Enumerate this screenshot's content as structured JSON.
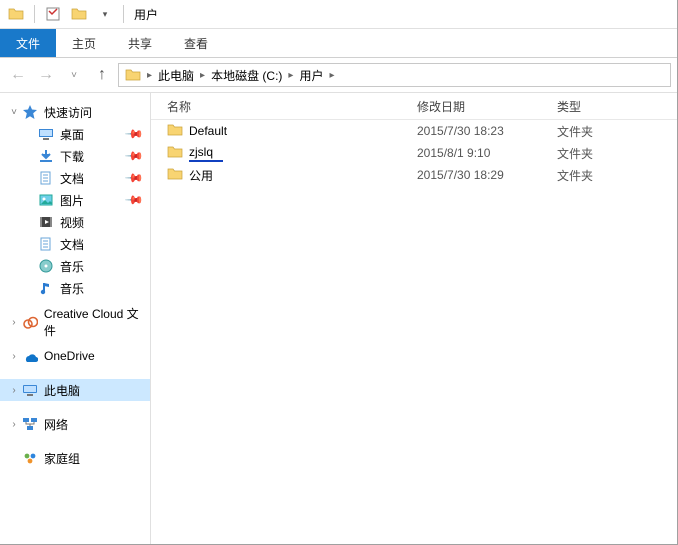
{
  "title": "用户",
  "ribbon": {
    "file": "文件",
    "home": "主页",
    "share": "共享",
    "view": "查看"
  },
  "breadcrumb": [
    "此电脑",
    "本地磁盘 (C:)",
    "用户"
  ],
  "columns": {
    "name": "名称",
    "date": "修改日期",
    "type": "类型"
  },
  "rows": [
    {
      "name": "Default",
      "date": "2015/7/30 18:23",
      "type": "文件夹",
      "mark": false
    },
    {
      "name": "zjslq",
      "date": "2015/8/1 9:10",
      "type": "文件夹",
      "mark": true
    },
    {
      "name": "公用",
      "date": "2015/7/30 18:29",
      "type": "文件夹",
      "mark": false
    }
  ],
  "nav": {
    "quick_access": "快速访问",
    "quick_items": [
      {
        "label": "桌面",
        "icon": "desktop",
        "pinned": true
      },
      {
        "label": "下载",
        "icon": "downloads",
        "pinned": true
      },
      {
        "label": "文档",
        "icon": "documents",
        "pinned": true
      },
      {
        "label": "图片",
        "icon": "pictures",
        "pinned": true
      },
      {
        "label": "视频",
        "icon": "videos",
        "pinned": false
      },
      {
        "label": "文档",
        "icon": "documents",
        "pinned": false
      },
      {
        "label": "音乐",
        "icon": "music-disc",
        "pinned": false
      },
      {
        "label": "音乐",
        "icon": "music-note",
        "pinned": false
      }
    ],
    "creative_cloud": "Creative Cloud 文件",
    "onedrive": "OneDrive",
    "this_pc": "此电脑",
    "network": "网络",
    "homegroup": "家庭组"
  }
}
